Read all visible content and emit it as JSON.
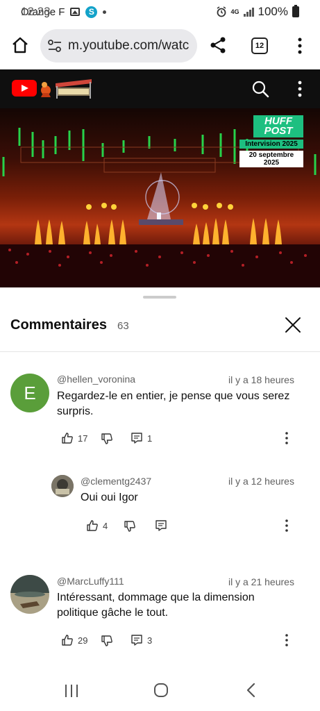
{
  "status_bar": {
    "carrier": "Orange F",
    "time": "12:23",
    "network": "4G",
    "battery": "100%"
  },
  "browser": {
    "url": "m.youtube.com/watc",
    "tab_count": "12"
  },
  "video": {
    "brand": "HUFF POST",
    "brand_line1": "HUFF",
    "brand_line2": "POST",
    "event": "Intervision 2025",
    "date": "20 septembre 2025"
  },
  "comments_panel": {
    "title": "Commentaires",
    "count": "63",
    "comments": [
      {
        "author": "@hellen_voronina",
        "avatar_letter": "E",
        "avatar_color": "#5a9e3a",
        "time": "il y a 18 heures",
        "text_line1": "Regardez-le en entier, je pense que vous serez",
        "text_line2": "surpris.",
        "likes": "17",
        "replies": "1"
      },
      {
        "author": "@clementg2437",
        "time": "il y a 12 heures",
        "text_line1": "Oui oui Igor",
        "likes": "4",
        "replies": ""
      },
      {
        "author": "@MarcLuffy111",
        "time": "il y a 21 heures",
        "text_line1": "Intéressant, dommage que la dimension",
        "text_line2": "politique gâche le tout.",
        "likes": "29",
        "replies": "3"
      }
    ]
  },
  "colors": {
    "youtube_red": "#ff0000",
    "huffpost_green": "#1dbf80",
    "secondary_text": "#606060"
  }
}
